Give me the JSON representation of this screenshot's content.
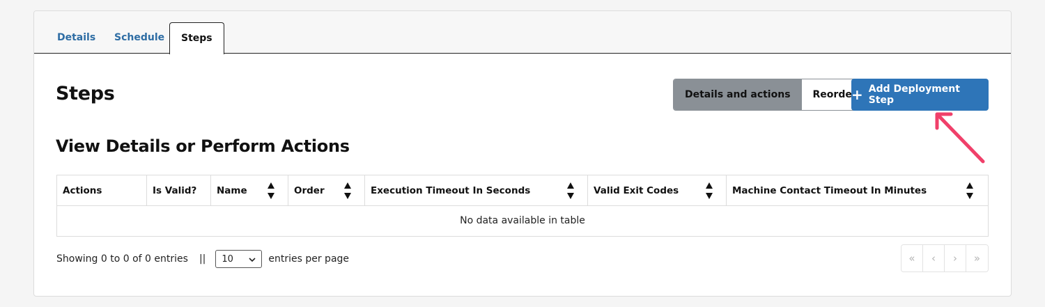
{
  "tabs": [
    {
      "label": "Details",
      "active": false
    },
    {
      "label": "Schedule",
      "active": false
    },
    {
      "label": "Steps",
      "active": true
    }
  ],
  "page_title": "Steps",
  "view_toggle": {
    "details_label": "Details and actions",
    "reorder_label": "Reorder",
    "selected": "Details and actions"
  },
  "add_button": {
    "icon": "plus-icon",
    "label": "Add Deployment Step"
  },
  "section_title": "View Details or Perform Actions",
  "table": {
    "columns": [
      {
        "label": "Actions",
        "sortable": false
      },
      {
        "label": "Is Valid?",
        "sortable": false
      },
      {
        "label": "Name",
        "sortable": true
      },
      {
        "label": "Order",
        "sortable": true
      },
      {
        "label": "Execution Timeout In Seconds",
        "sortable": true
      },
      {
        "label": "Valid Exit Codes",
        "sortable": true
      },
      {
        "label": "Machine Contact Timeout In Minutes",
        "sortable": true
      }
    ],
    "empty_message": "No data available in table"
  },
  "footer": {
    "info": "Showing 0 to 0 of 0 entries",
    "separator": "||",
    "page_size": "10",
    "per_page_label": "entries per page"
  },
  "pagination": {
    "first": "«",
    "prev": "‹",
    "next": "›",
    "last": "»"
  },
  "colors": {
    "primary": "#2e75b8",
    "toggle_active": "#8a9096",
    "annotation_arrow": "#f0406a"
  }
}
